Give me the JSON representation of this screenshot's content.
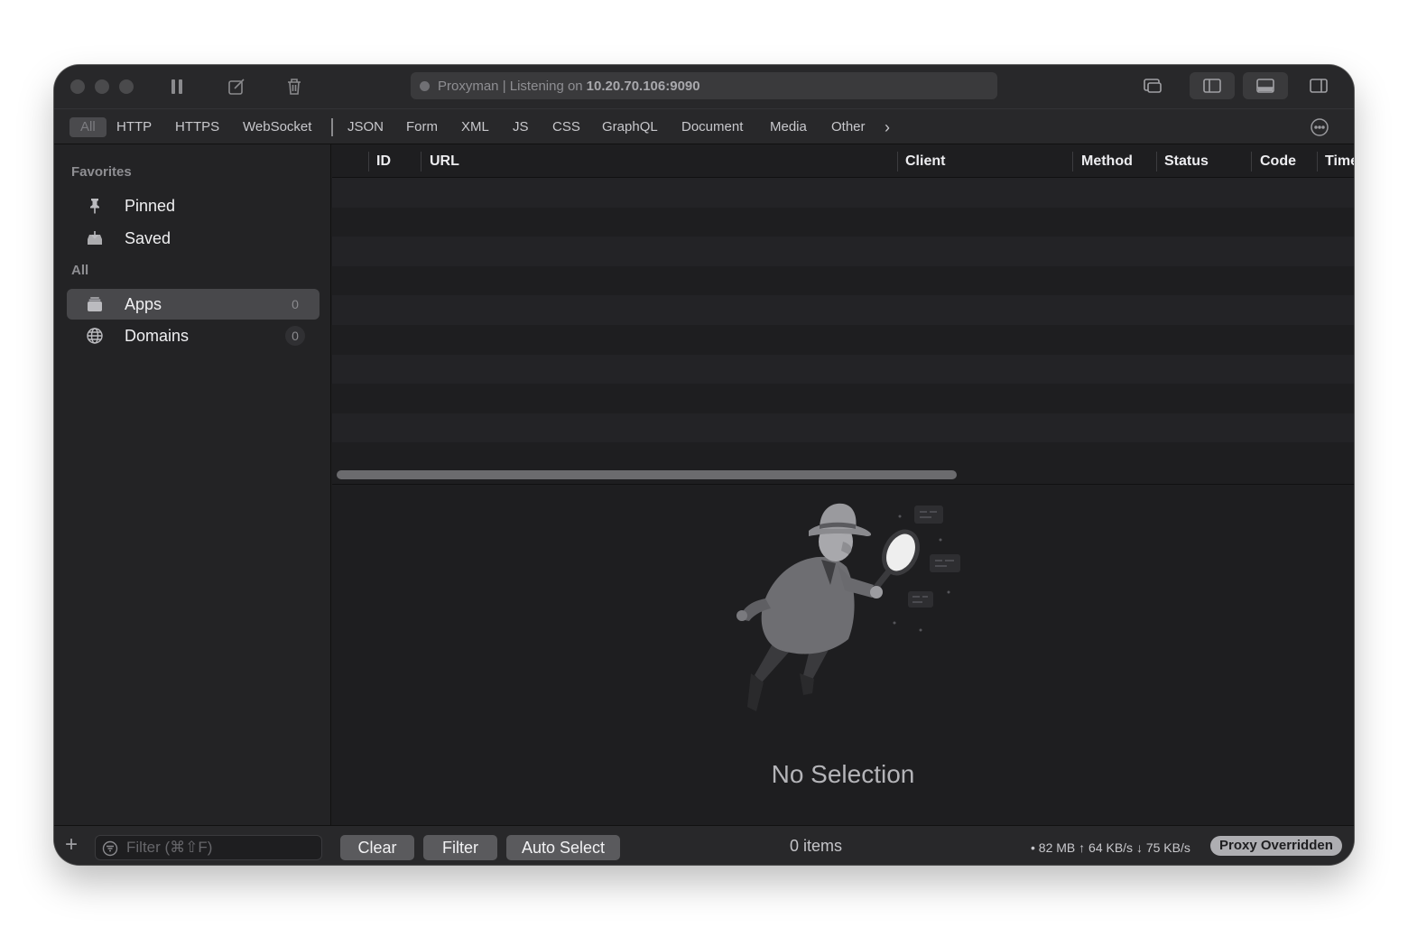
{
  "titlebar": {
    "address_prefix": "Proxyman | Listening on",
    "address_host": "10.20.70.106:9090"
  },
  "tabs": {
    "all": "All",
    "items": [
      "HTTP",
      "HTTPS",
      "WebSocket",
      "JSON",
      "Form",
      "XML",
      "JS",
      "CSS",
      "GraphQL",
      "Document",
      "Media",
      "Other"
    ],
    "more": "›"
  },
  "sidebar": {
    "favorites_header": "Favorites",
    "pinned": "Pinned",
    "saved": "Saved",
    "all_header": "All",
    "apps": "Apps",
    "apps_count": "0",
    "domains": "Domains",
    "domains_count": "0"
  },
  "table": {
    "columns": [
      "ID",
      "URL",
      "Client",
      "Method",
      "Status",
      "Code",
      "Time"
    ]
  },
  "detail": {
    "empty_text": "No Selection"
  },
  "bottombar": {
    "add": "+",
    "filter_placeholder": "Filter (⌘⇧F)",
    "clear": "Clear",
    "filter": "Filter",
    "auto_select": "Auto Select",
    "items_count": "0 items",
    "stats": "• 82 MB ↑ 64 KB/s ↓ 75 KB/s",
    "proxy_badge": "Proxy Overridden"
  }
}
